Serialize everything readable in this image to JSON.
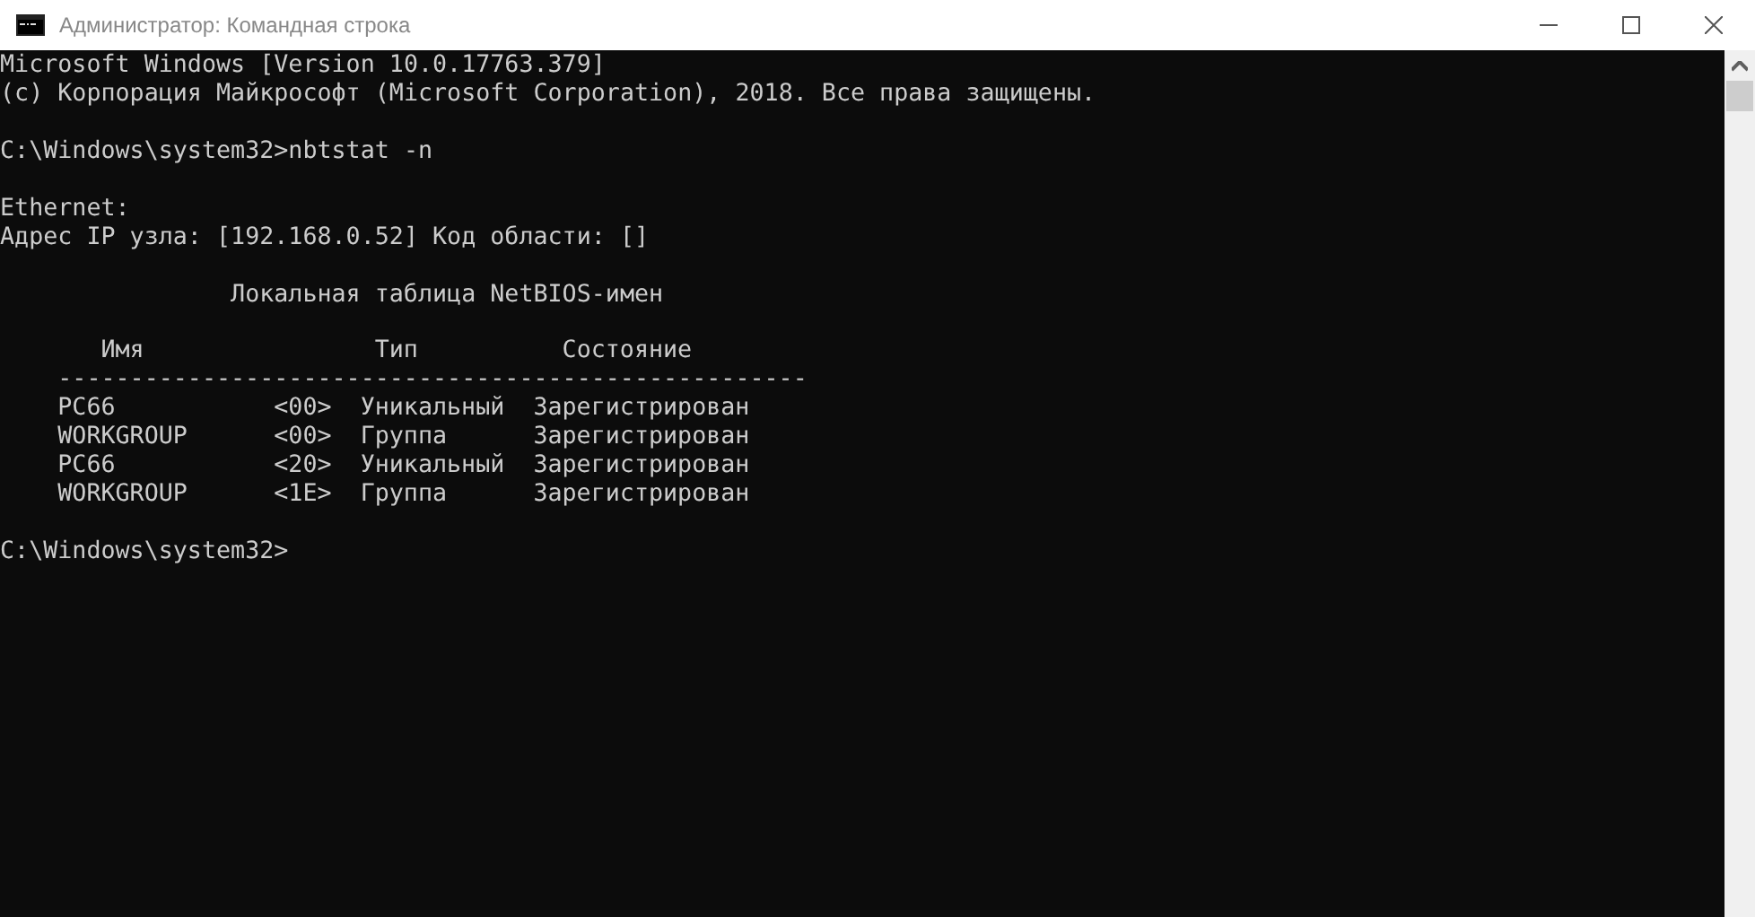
{
  "window": {
    "title": "Администратор: Командная строка"
  },
  "console": [
    {
      "kind": "text",
      "text": "Microsoft Windows [Version 10.0.17763.379]"
    },
    {
      "kind": "text",
      "text": "(c) Корпорация Майкрософт (Microsoft Corporation), 2018. Все права защищены."
    },
    {
      "kind": "blank"
    },
    {
      "kind": "text",
      "text": "C:\\Windows\\system32>nbtstat -n"
    },
    {
      "kind": "blank"
    },
    {
      "kind": "text",
      "text": "Ethernet:"
    },
    {
      "kind": "text",
      "text": "Адрес IP узла: [192.168.0.52] Код области: []"
    },
    {
      "kind": "blank"
    },
    {
      "kind": "caption",
      "text": "Локальная таблица NetBIOS-имен"
    },
    {
      "kind": "blank"
    },
    {
      "kind": "header",
      "cells": [
        "Имя",
        "Тип",
        "Состояние"
      ]
    },
    {
      "kind": "rule",
      "text": "----------------------------------------------------"
    },
    {
      "kind": "row",
      "cells": [
        "PC66",
        "<00>",
        "Уникальный",
        "Зарегистрирован"
      ]
    },
    {
      "kind": "row",
      "cells": [
        "WORKGROUP",
        "<00>",
        "Группа",
        "Зарегистрирован"
      ]
    },
    {
      "kind": "row",
      "cells": [
        "PC66",
        "<20>",
        "Уникальный",
        "Зарегистрирован"
      ]
    },
    {
      "kind": "row",
      "cells": [
        "WORKGROUP",
        "<1E>",
        "Группа",
        "Зарегистрирован"
      ]
    },
    {
      "kind": "blank"
    },
    {
      "kind": "text",
      "text": "C:\\Windows\\system32>"
    }
  ]
}
